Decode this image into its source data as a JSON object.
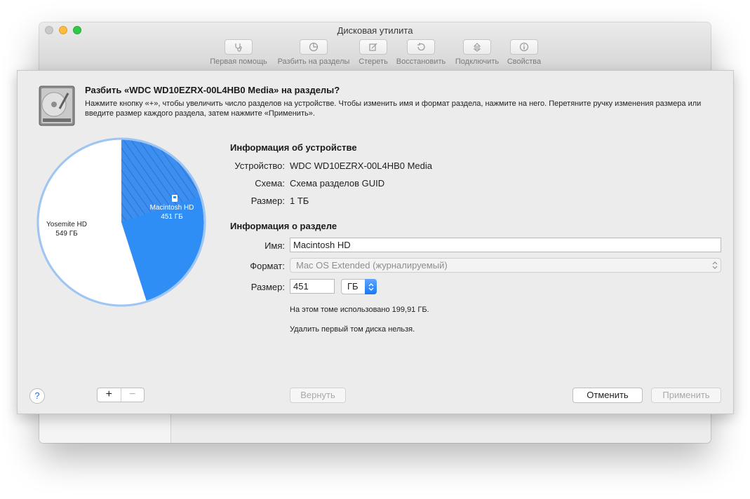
{
  "window": {
    "title": "Дисковая утилита"
  },
  "toolbar": {
    "items": [
      {
        "label": "Первая помощь",
        "icon": "stethoscope-icon"
      },
      {
        "label": "Разбить на разделы",
        "icon": "pie-partition-icon"
      },
      {
        "label": "Стереть",
        "icon": "erase-icon"
      },
      {
        "label": "Восстановить",
        "icon": "restore-icon"
      },
      {
        "label": "Подключить",
        "icon": "mount-icon"
      },
      {
        "label": "Свойства",
        "icon": "info-icon"
      }
    ]
  },
  "sheet": {
    "title": "Разбить «WDC WD10EZRX-00L4HB0 Media» на разделы?",
    "description": "Нажмите кнопку «+», чтобы увеличить число разделов на устройстве. Чтобы изменить имя и формат раздела, нажмите на него. Перетяните ручку изменения размера или введите размер каждого раздела, затем нажмите «Применить»."
  },
  "pie": {
    "partitions": [
      {
        "name": "Macintosh HD",
        "size": "451 ГБ",
        "size_gb": 451,
        "selected": true,
        "color": "#2f8ef5",
        "used_fraction": 0.443
      },
      {
        "name": "Yosemite HD",
        "size": "549 ГБ",
        "size_gb": 549,
        "selected": false,
        "color": "#ffffff"
      }
    ],
    "outline_color": "#9fc6f2"
  },
  "device_info": {
    "heading": "Информация об устройстве",
    "device_label": "Устройство:",
    "device_value": "WDC WD10EZRX-00L4HB0 Media",
    "scheme_label": "Схема:",
    "scheme_value": "Схема разделов GUID",
    "size_label": "Размер:",
    "size_value": "1 ТБ"
  },
  "partition_info": {
    "heading": "Информация о разделе",
    "name_label": "Имя:",
    "name_value": "Macintosh HD",
    "format_label": "Формат:",
    "format_value": "Mac OS Extended (журналируемый)",
    "size_label": "Размер:",
    "size_value": "451",
    "unit_value": "ГБ",
    "used_note": "На этом томе использовано 199,91 ГБ.",
    "delete_note": "Удалить первый том диска нельзя."
  },
  "buttons": {
    "help": "?",
    "add": "+",
    "remove": "−",
    "revert": "Вернуть",
    "cancel": "Отменить",
    "apply": "Применить"
  }
}
